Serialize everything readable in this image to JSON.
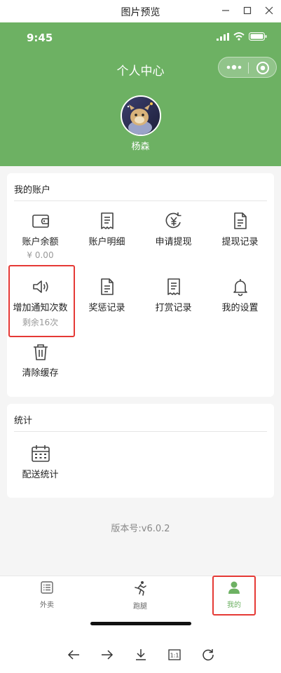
{
  "window": {
    "title": "图片预览"
  },
  "status": {
    "time": "9:45"
  },
  "header": {
    "title": "个人中心",
    "username": "杨森"
  },
  "account": {
    "title": "我的账户",
    "items": [
      {
        "icon": "wallet-icon",
        "label": "账户余额",
        "sub": "¥ 0.00"
      },
      {
        "icon": "bill-detail-icon",
        "label": "账户明细"
      },
      {
        "icon": "withdraw-apply-icon",
        "label": "申请提现"
      },
      {
        "icon": "withdraw-record-icon",
        "label": "提现记录"
      },
      {
        "icon": "speaker-icon",
        "label": "增加通知次数",
        "sub": "剩余16次"
      },
      {
        "icon": "reward-record-icon",
        "label": "奖惩记录"
      },
      {
        "icon": "tip-record-icon",
        "label": "打赏记录"
      },
      {
        "icon": "bell-icon",
        "label": "我的设置"
      },
      {
        "icon": "trash-icon",
        "label": "清除缓存"
      }
    ]
  },
  "stats": {
    "title": "统计",
    "items": [
      {
        "icon": "calendar-icon",
        "label": "配送统计"
      }
    ]
  },
  "version": "版本号:v6.0.2",
  "tabs": [
    {
      "icon": "list-icon",
      "label": "外卖"
    },
    {
      "icon": "runner-icon",
      "label": "跑腿"
    },
    {
      "icon": "person-icon",
      "label": "我的",
      "active": true
    }
  ],
  "colors": {
    "brand_green": "#6db163",
    "highlight_red": "#e53935"
  }
}
